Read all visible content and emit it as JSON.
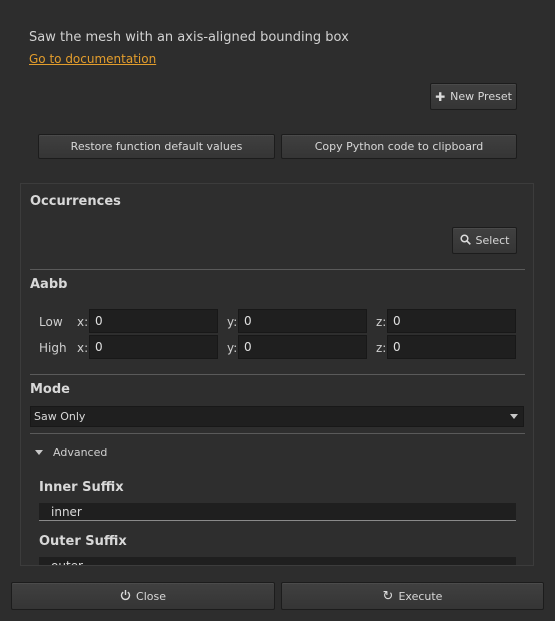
{
  "description": "Saw the mesh with an axis-aligned bounding box",
  "doc_link": "Go to documentation",
  "new_preset": {
    "label": "New Preset",
    "icon": "plus-icon"
  },
  "restore_button": "Restore function default values",
  "copy_button": "Copy Python code to clipboard",
  "occurrences": {
    "title": "Occurrences",
    "select_label": "Select",
    "select_icon": "search-icon"
  },
  "aabb": {
    "title": "Aabb",
    "rows": [
      {
        "label": "Low",
        "x": "0",
        "y": "0",
        "z": "0"
      },
      {
        "label": "High",
        "x": "0",
        "y": "0",
        "z": "0"
      }
    ],
    "axis_x": "x:",
    "axis_y": "y:",
    "axis_z": "z:"
  },
  "mode": {
    "title": "Mode",
    "selected": "Saw Only"
  },
  "advanced": {
    "label": "Advanced",
    "expanded": true
  },
  "inner_suffix": {
    "title": "Inner Suffix",
    "value": "inner"
  },
  "outer_suffix": {
    "title": "Outer Suffix",
    "value": "outer"
  },
  "footer": {
    "close_label": "Close",
    "close_icon": "power-icon",
    "execute_label": "Execute",
    "execute_icon": "refresh-icon"
  },
  "colors": {
    "accent_link": "#e39d2c",
    "background": "#2d2d2d"
  }
}
